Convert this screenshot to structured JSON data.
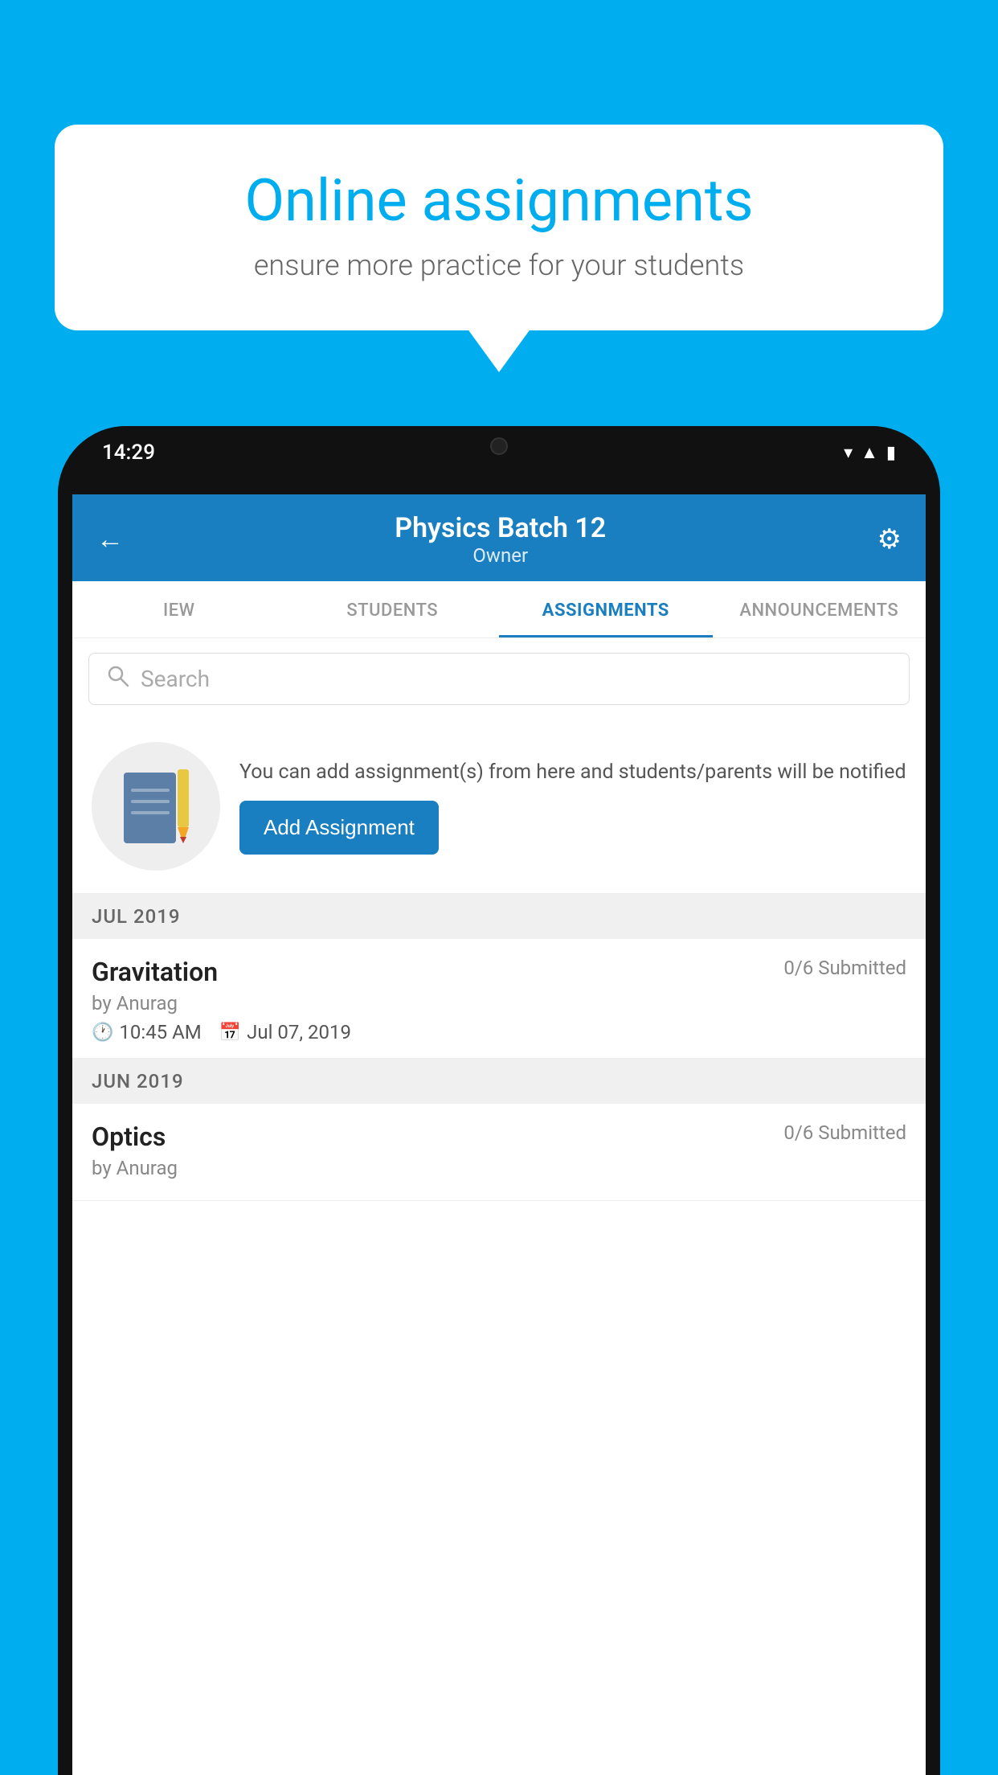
{
  "background_color": "#00AEEF",
  "speech_bubble": {
    "title": "Online assignments",
    "subtitle": "ensure more practice for your students"
  },
  "phone": {
    "status_bar": {
      "time": "14:29",
      "icons": [
        "wifi",
        "signal",
        "battery"
      ]
    },
    "header": {
      "title": "Physics Batch 12",
      "subtitle": "Owner",
      "back_label": "←",
      "settings_label": "⚙"
    },
    "tabs": [
      {
        "label": "IEW",
        "active": false
      },
      {
        "label": "STUDENTS",
        "active": false
      },
      {
        "label": "ASSIGNMENTS",
        "active": true
      },
      {
        "label": "ANNOUNCEMENTS",
        "active": false
      }
    ],
    "search": {
      "placeholder": "Search"
    },
    "promo": {
      "description": "You can add assignment(s) from here and students/parents will be notified",
      "button_label": "Add Assignment"
    },
    "assignments": [
      {
        "month_header": "JUL 2019",
        "name": "Gravitation",
        "submitted": "0/6 Submitted",
        "author": "by Anurag",
        "time": "10:45 AM",
        "date": "Jul 07, 2019"
      },
      {
        "month_header": "JUN 2019",
        "name": "Optics",
        "submitted": "0/6 Submitted",
        "author": "by Anurag",
        "time": "",
        "date": ""
      }
    ]
  }
}
